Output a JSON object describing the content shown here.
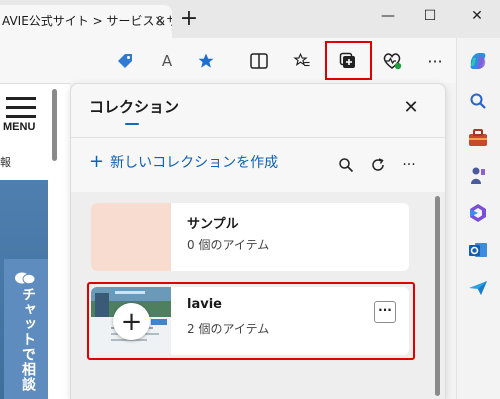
{
  "browser": {
    "tab_title": "AVIE公式サイト > サービス＆サ",
    "tab_close": "×",
    "new_tab": "+",
    "minimize": "—",
    "maximize": "☐",
    "close": "✕"
  },
  "toolbar": {
    "read_aloud": "A",
    "more": "···",
    "highlight_color": "#e00000"
  },
  "page": {
    "menu_label": "MENU",
    "side_text": "報",
    "chat_label": "チャットで相談"
  },
  "collections": {
    "title": "コレクション",
    "close": "✕",
    "new_collection": "新しいコレクションを作成",
    "new_plus": "+",
    "more": "···",
    "items": [
      {
        "title": "サンプル",
        "count": "0 個のアイテム"
      },
      {
        "title": "lavie",
        "count": "2 個のアイテム",
        "more": "···"
      }
    ]
  },
  "colors": {
    "accent": "#0f6cbd",
    "highlight": "#e00000",
    "sample_thumb": "#f9dcd0"
  }
}
